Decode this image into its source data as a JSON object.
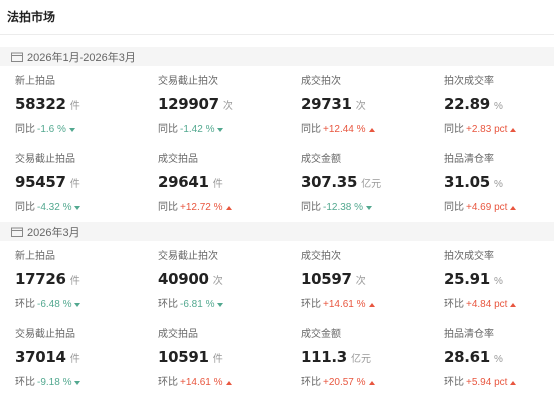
{
  "page": {
    "title": "法拍市场"
  },
  "colors": {
    "increase": "#e8563f",
    "decrease": "#52a88f"
  },
  "sections": [
    {
      "period": "2026年1月-2026年3月",
      "icon": "calendar-icon",
      "metrics": [
        {
          "label": "新上拍品",
          "value": "58322",
          "unit": "件",
          "change_prefix": "同比",
          "change": "-1.6 %",
          "direction": "down"
        },
        {
          "label": "交易截止拍次",
          "value": "129907",
          "unit": "次",
          "change_prefix": "同比",
          "change": "-1.42 %",
          "direction": "down"
        },
        {
          "label": "成交拍次",
          "value": "29731",
          "unit": "次",
          "change_prefix": "同比",
          "change": "+12.44 %",
          "direction": "up"
        },
        {
          "label": "拍次成交率",
          "value": "22.89",
          "unit": "%",
          "change_prefix": "同比",
          "change": "+2.83 pct",
          "direction": "up"
        },
        {
          "label": "交易截止拍品",
          "value": "95457",
          "unit": "件",
          "change_prefix": "同比",
          "change": "-4.32 %",
          "direction": "down"
        },
        {
          "label": "成交拍品",
          "value": "29641",
          "unit": "件",
          "change_prefix": "同比",
          "change": "+12.72 %",
          "direction": "up"
        },
        {
          "label": "成交金额",
          "value": "307.35",
          "unit": "亿元",
          "change_prefix": "同比",
          "change": "-12.38 %",
          "direction": "down"
        },
        {
          "label": "拍品清仓率",
          "value": "31.05",
          "unit": "%",
          "change_prefix": "同比",
          "change": "+4.69 pct",
          "direction": "up"
        }
      ]
    },
    {
      "period": "2026年3月",
      "icon": "calendar-icon",
      "metrics": [
        {
          "label": "新上拍品",
          "value": "17726",
          "unit": "件",
          "change_prefix": "环比",
          "change": "-6.48 %",
          "direction": "down"
        },
        {
          "label": "交易截止拍次",
          "value": "40900",
          "unit": "次",
          "change_prefix": "环比",
          "change": "-6.81 %",
          "direction": "down"
        },
        {
          "label": "成交拍次",
          "value": "10597",
          "unit": "次",
          "change_prefix": "环比",
          "change": "+14.61 %",
          "direction": "up"
        },
        {
          "label": "拍次成交率",
          "value": "25.91",
          "unit": "%",
          "change_prefix": "环比",
          "change": "+4.84 pct",
          "direction": "up"
        },
        {
          "label": "交易截止拍品",
          "value": "37014",
          "unit": "件",
          "change_prefix": "环比",
          "change": "-9.18 %",
          "direction": "down"
        },
        {
          "label": "成交拍品",
          "value": "10591",
          "unit": "件",
          "change_prefix": "环比",
          "change": "+14.61 %",
          "direction": "up"
        },
        {
          "label": "成交金额",
          "value": "111.3",
          "unit": "亿元",
          "change_prefix": "环比",
          "change": "+20.57 %",
          "direction": "up"
        },
        {
          "label": "拍品清仓率",
          "value": "28.61",
          "unit": "%",
          "change_prefix": "环比",
          "change": "+5.94 pct",
          "direction": "up"
        }
      ]
    }
  ]
}
